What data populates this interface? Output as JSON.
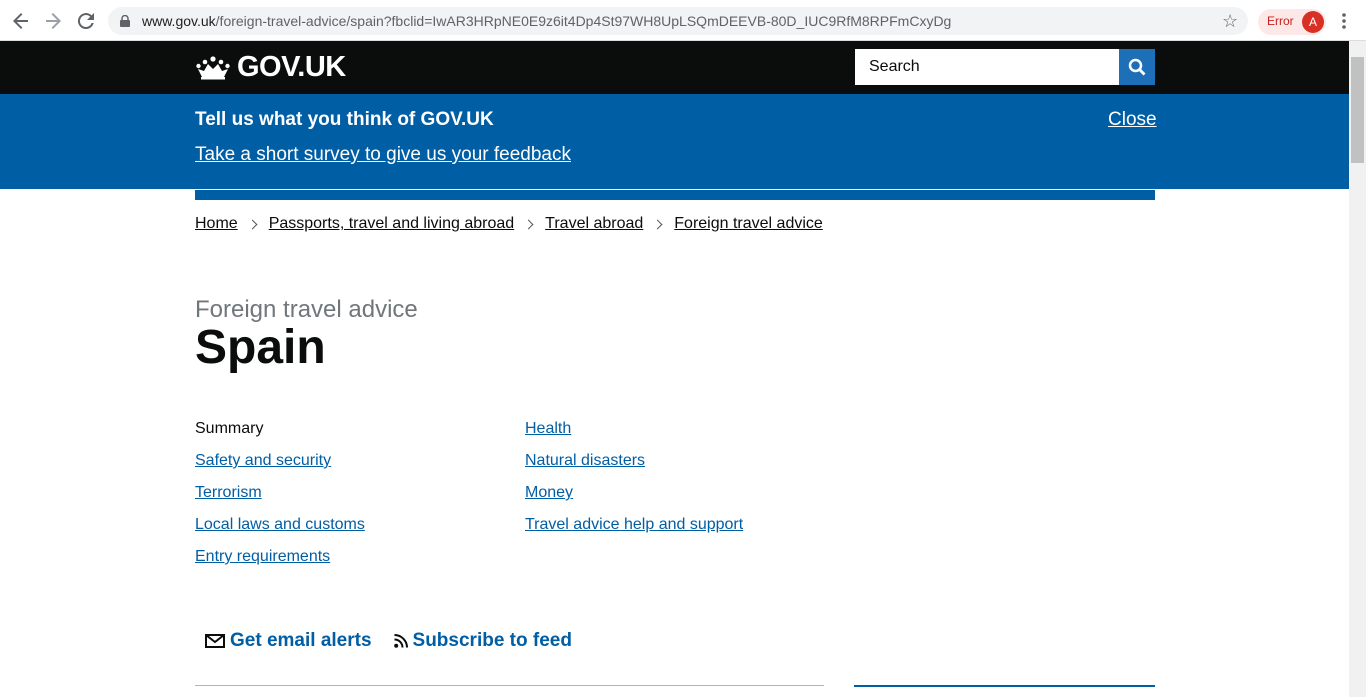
{
  "browser": {
    "url_host": "www.gov.uk",
    "url_path": "/foreign-travel-advice/spain?fbclid=IwAR3HRpNE0E9z6it4Dp4St97WH8UpLSQmDEEVB-80D_IUC9RfM8RPFmCxyDg",
    "error_label": "Error",
    "avatar_letter": "A"
  },
  "header": {
    "logo_text": "GOV.UK",
    "search_placeholder": "Search"
  },
  "survey": {
    "title": "Tell us what you think of GOV.UK",
    "link": "Take a short survey to give us your feedback",
    "close": "Close"
  },
  "breadcrumb": [
    "Home",
    "Passports, travel and living abroad",
    "Travel abroad",
    "Foreign travel advice"
  ],
  "page": {
    "caption": "Foreign travel advice",
    "title": "Spain"
  },
  "parts": {
    "left": [
      "Summary",
      "Safety and security",
      "Terrorism",
      "Local laws and customs",
      "Entry requirements"
    ],
    "right": [
      "Health",
      "Natural disasters",
      "Money",
      "Travel advice help and support"
    ]
  },
  "subscriptions": {
    "email": "Get email alerts",
    "feed": "Subscribe to feed"
  },
  "colors": {
    "header_bg": "#0b0c0c",
    "survey_bg": "#005ea5",
    "link": "#005ea5"
  }
}
